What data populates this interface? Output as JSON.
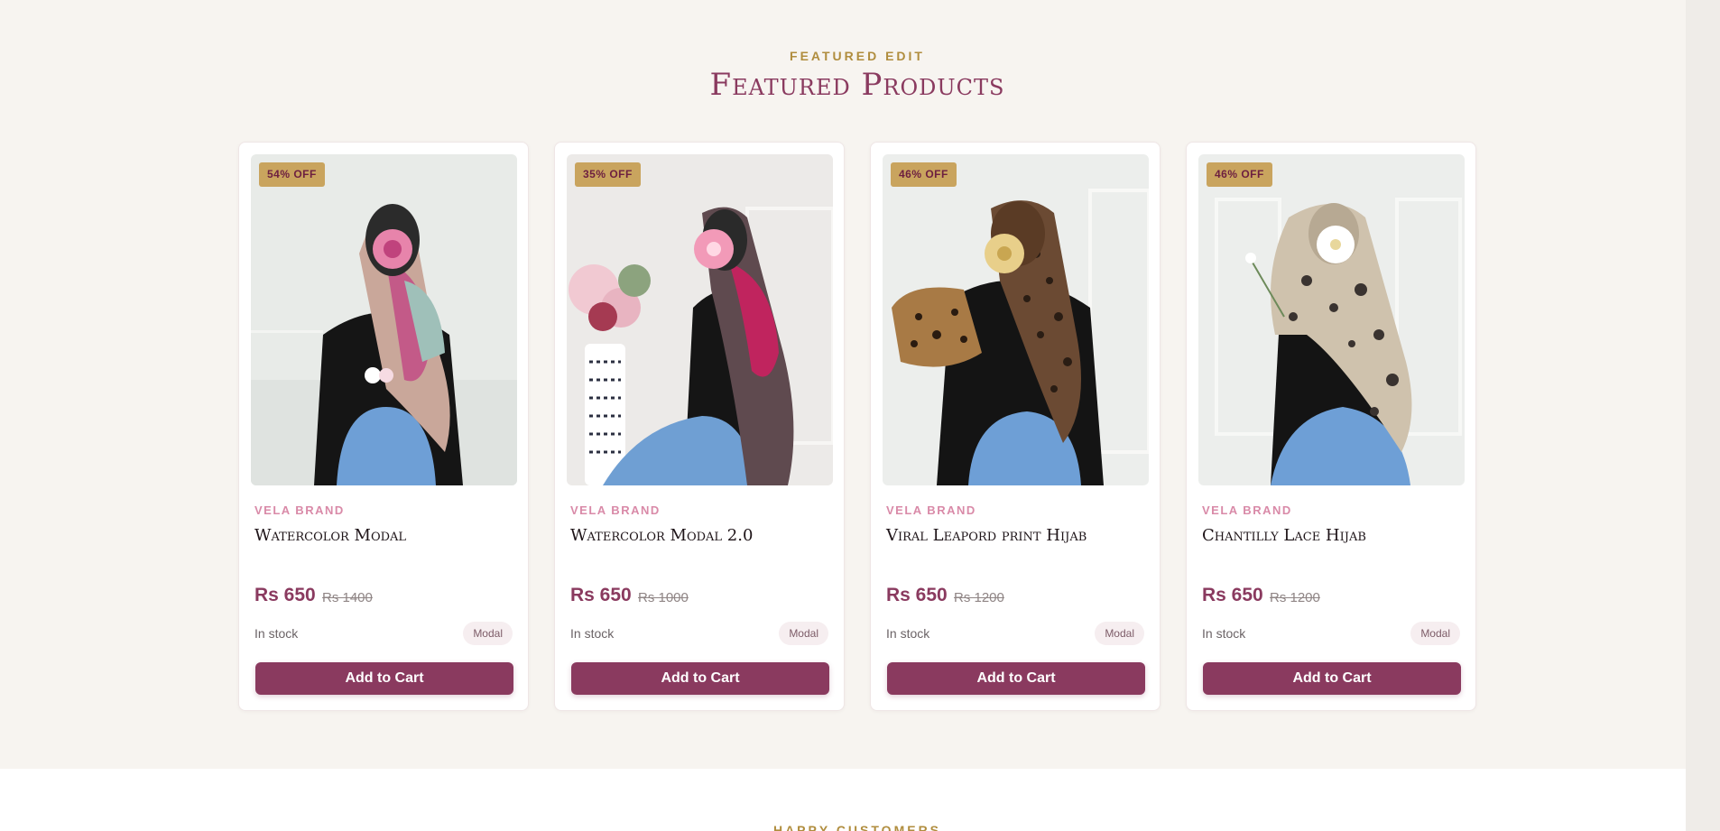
{
  "section": {
    "eyebrow": "FEATURED EDIT",
    "title": "Featured Products"
  },
  "products": [
    {
      "badge": "54% OFF",
      "brand": "VELA BRAND",
      "name": "Watercolor Modal",
      "price": "Rs 650",
      "old_price": "Rs 1400",
      "stock": "In stock",
      "tag": "Modal",
      "cta": "Add to Cart"
    },
    {
      "badge": "35% OFF",
      "brand": "VELA BRAND",
      "name": "Watercolor Modal 2.0",
      "price": "Rs 650",
      "old_price": "Rs 1000",
      "stock": "In stock",
      "tag": "Modal",
      "cta": "Add to Cart"
    },
    {
      "badge": "46% OFF",
      "brand": "VELA BRAND",
      "name": "Viral Leapord print Hijab",
      "price": "Rs 650",
      "old_price": "Rs 1200",
      "stock": "In stock",
      "tag": "Modal",
      "cta": "Add to Cart"
    },
    {
      "badge": "46% OFF",
      "brand": "VELA BRAND",
      "name": "Chantilly Lace Hijab",
      "price": "Rs 650",
      "old_price": "Rs 1200",
      "stock": "In stock",
      "tag": "Modal",
      "cta": "Add to Cart"
    }
  ],
  "next_section": {
    "eyebrow": "HAPPY CUSTOMERS"
  },
  "colors": {
    "accent": "#8a3a5f",
    "gold": "#c9a45e",
    "background": "#f7f4f0"
  }
}
